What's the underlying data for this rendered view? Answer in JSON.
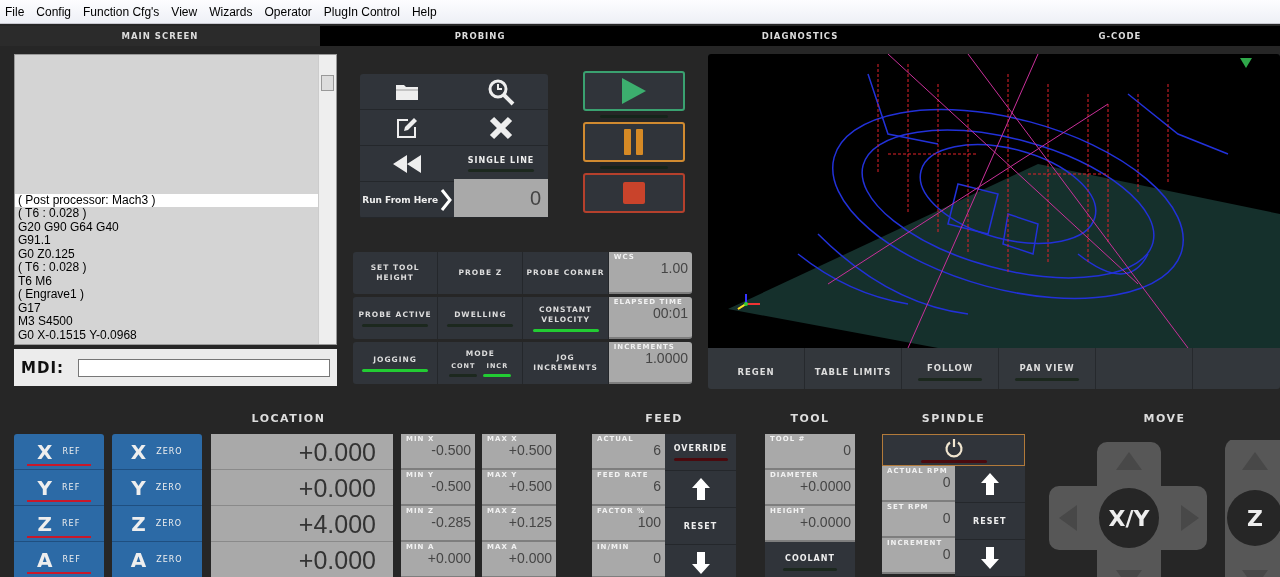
{
  "menu": [
    "File",
    "Config",
    "Function Cfg's",
    "View",
    "Wizards",
    "Operator",
    "PlugIn Control",
    "Help"
  ],
  "tabs": [
    {
      "label": "MAIN SCREEN",
      "selected": true
    },
    {
      "label": "PROBING",
      "selected": false
    },
    {
      "label": "DIAGNOSTICS",
      "selected": false
    },
    {
      "label": "G-CODE",
      "selected": false
    }
  ],
  "gcode": {
    "lines": [
      {
        "text": "( Post processor: Mach3 )",
        "selected": true
      },
      {
        "text": "( T6 : 0.028 )",
        "selected": false
      },
      {
        "text": "G20 G90 G64 G40",
        "selected": false
      },
      {
        "text": "G91.1",
        "selected": false
      },
      {
        "text": "G0 Z0.125",
        "selected": false
      },
      {
        "text": "( T6 : 0.028 )",
        "selected": false
      },
      {
        "text": "T6 M6",
        "selected": false
      },
      {
        "text": "( Engrave1 )",
        "selected": false
      },
      {
        "text": "G17",
        "selected": false
      },
      {
        "text": "M3 S4500",
        "selected": false
      },
      {
        "text": "G0 X-0.1515 Y-0.0968",
        "selected": false
      }
    ]
  },
  "mdi": {
    "label": "MDI:"
  },
  "file_controls": {
    "single_line": {
      "label": "SINGLE LINE",
      "on": false
    },
    "run_from_here": {
      "label": "Run From Here",
      "value": "0"
    }
  },
  "cycle": {
    "start_on": false,
    "pause_on": false
  },
  "status_rows": [
    {
      "buttons": [
        {
          "kind": "button",
          "label": "SET TOOL HEIGHT"
        },
        {
          "kind": "button",
          "label": "PROBE Z"
        },
        {
          "kind": "button",
          "label": "PROBE CORNER"
        }
      ],
      "readout": {
        "label": "WCS",
        "value": "1.00"
      }
    },
    {
      "buttons": [
        {
          "kind": "led",
          "label": "PROBE ACTIVE",
          "on": false
        },
        {
          "kind": "led",
          "label": "DWELLING",
          "on": false
        },
        {
          "kind": "led",
          "label": "CONSTANT VELOCITY",
          "on": true
        }
      ],
      "readout": {
        "label": "ELAPSED TIME",
        "value": "00:01"
      }
    },
    {
      "buttons": [
        {
          "kind": "led",
          "label": "JOGGING",
          "on": true
        },
        {
          "kind": "mode",
          "label": "MODE",
          "options": [
            {
              "label": "CONT",
              "selected": false
            },
            {
              "label": "INCR",
              "selected": true
            }
          ]
        },
        {
          "kind": "button",
          "label": "JOG INCREMENTS"
        }
      ],
      "readout": {
        "label": "INCREMENTS",
        "value": "1.0000"
      }
    }
  ],
  "view_buttons": [
    {
      "kind": "button",
      "label": "REGEN"
    },
    {
      "kind": "button",
      "label": "TABLE LIMITS"
    },
    {
      "kind": "led",
      "label": "FOLLOW",
      "on": false
    },
    {
      "kind": "led",
      "label": "PAN VIEW",
      "on": false
    }
  ],
  "location": {
    "title": "LOCATION",
    "axes": [
      {
        "ref": {
          "axis": "X",
          "label": "REF",
          "homed": false
        },
        "zero": {
          "axis": "X",
          "label": "ZERO"
        },
        "value": "+0.000",
        "min_label": "MIN X",
        "min": "-0.500",
        "max_label": "MAX X",
        "max": "+0.500"
      },
      {
        "ref": {
          "axis": "Y",
          "label": "REF",
          "homed": false
        },
        "zero": {
          "axis": "Y",
          "label": "ZERO"
        },
        "value": "+0.000",
        "min_label": "MIN Y",
        "min": "-0.500",
        "max_label": "MAX Y",
        "max": "+0.500"
      },
      {
        "ref": {
          "axis": "Z",
          "label": "REF",
          "homed": false
        },
        "zero": {
          "axis": "Z",
          "label": "ZERO"
        },
        "value": "+4.000",
        "min_label": "MIN Z",
        "min": "-0.285",
        "max_label": "MAX Z",
        "max": "+0.125"
      },
      {
        "ref": {
          "axis": "A",
          "label": "REF",
          "homed": false
        },
        "zero": {
          "axis": "A",
          "label": "ZERO"
        },
        "value": "+0.000",
        "min_label": "MIN A",
        "min": "+0.000",
        "max_label": "MAX A",
        "max": "+0.000"
      }
    ]
  },
  "feed": {
    "title": "FEED",
    "readouts": [
      {
        "label": "ACTUAL",
        "value": "6"
      },
      {
        "label": "FEED RATE",
        "value": "6"
      },
      {
        "label": "FACTOR %",
        "value": "100"
      },
      {
        "label": "IN/MIN",
        "value": "0"
      }
    ],
    "buttons": [
      {
        "kind": "override",
        "label": "OVERRIDE",
        "on": false
      },
      {
        "kind": "up"
      },
      {
        "kind": "reset",
        "label": "RESET"
      },
      {
        "kind": "down"
      }
    ]
  },
  "tool": {
    "title": "TOOL",
    "readouts": [
      {
        "label": "TOOL #",
        "value": "0"
      },
      {
        "label": "DIAMETER",
        "value": "+0.0000"
      },
      {
        "label": "HEIGHT",
        "value": "+0.0000"
      }
    ],
    "coolant": {
      "label": "COOLANT",
      "on": false
    }
  },
  "spindle": {
    "title": "SPINDLE",
    "on": false,
    "readouts": [
      {
        "label": "ACTUAL RPM",
        "value": "0"
      },
      {
        "label": "SET RPM",
        "value": "0"
      },
      {
        "label": "INCREMENT",
        "value": "0"
      }
    ],
    "buttons": [
      {
        "kind": "up"
      },
      {
        "kind": "reset",
        "label": "RESET"
      },
      {
        "kind": "down"
      }
    ]
  },
  "move": {
    "title": "MOVE",
    "xy_label": "X/Y",
    "z_label": "Z"
  }
}
